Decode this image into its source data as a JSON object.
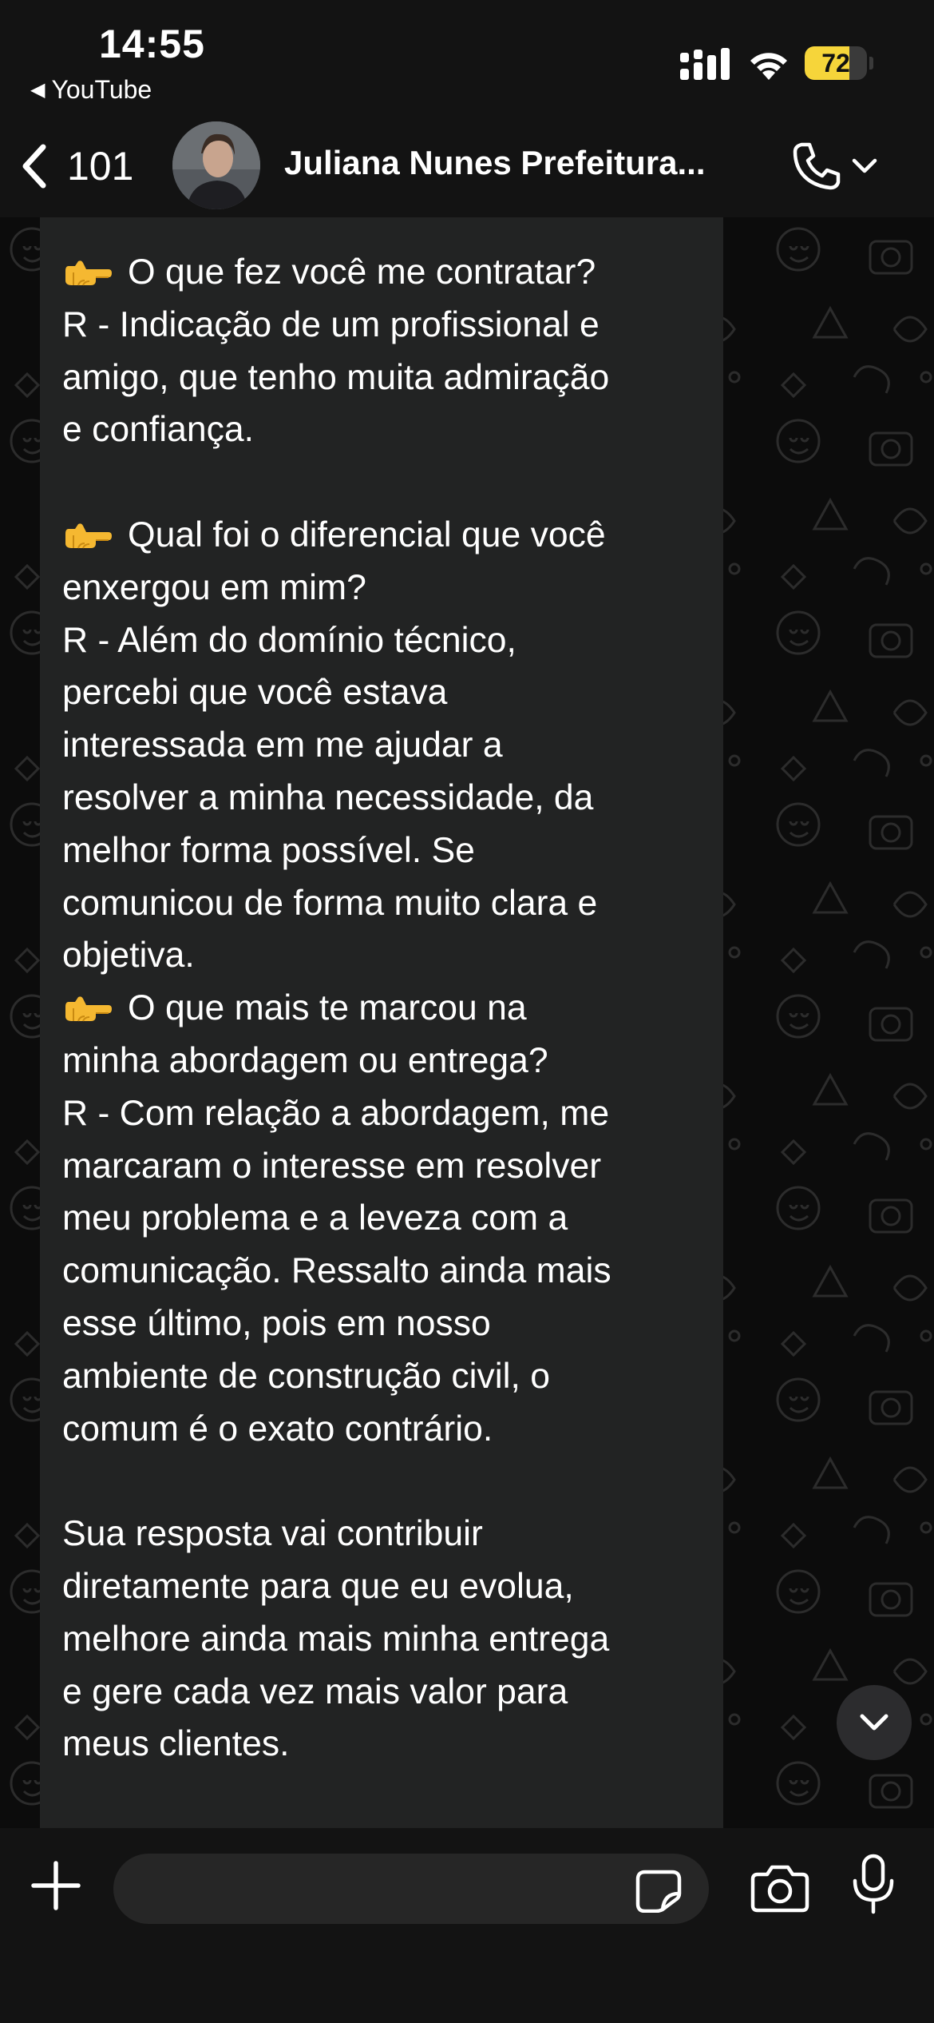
{
  "status_bar": {
    "time": "14:55",
    "back_app": "YouTube",
    "battery_percent": "72",
    "battery_level": 0.72,
    "battery_color": "#f6d53a"
  },
  "header": {
    "unread_count": "101",
    "contact_name": "Juliana Nunes Prefeitura...",
    "back_icon": "chevron-left-icon",
    "call_icon": "phone-icon"
  },
  "message": {
    "lines": [
      {
        "emoji": true,
        "text": "O que fez você me contratar?"
      },
      {
        "emoji": false,
        "text": "R - Indicação de um profissional e"
      },
      {
        "emoji": false,
        "text": "amigo, que tenho muita admiração"
      },
      {
        "emoji": false,
        "text": "e confiança."
      },
      {
        "emoji": false,
        "text": ""
      },
      {
        "emoji": true,
        "text": "Qual foi o diferencial que você"
      },
      {
        "emoji": false,
        "text": "enxergou em mim?"
      },
      {
        "emoji": false,
        "text": "R - Além do domínio técnico,"
      },
      {
        "emoji": false,
        "text": "percebi que você estava"
      },
      {
        "emoji": false,
        "text": "interessada em me ajudar a"
      },
      {
        "emoji": false,
        "text": "resolver a minha necessidade, da"
      },
      {
        "emoji": false,
        "text": "melhor forma possível. Se"
      },
      {
        "emoji": false,
        "text": "comunicou de forma muito clara e"
      },
      {
        "emoji": false,
        "text": "objetiva."
      },
      {
        "emoji": true,
        "text": "O que mais te marcou na"
      },
      {
        "emoji": false,
        "text": "minha abordagem ou entrega?"
      },
      {
        "emoji": false,
        "text": "R - Com relação a abordagem, me"
      },
      {
        "emoji": false,
        "text": "marcaram o interesse em resolver"
      },
      {
        "emoji": false,
        "text": "meu problema e a leveza com a"
      },
      {
        "emoji": false,
        "text": "comunicação. Ressalto ainda mais"
      },
      {
        "emoji": false,
        "text": "esse último, pois em nosso"
      },
      {
        "emoji": false,
        "text": "ambiente de construção civil, o"
      },
      {
        "emoji": false,
        "text": "comum é o exato contrário."
      },
      {
        "emoji": false,
        "text": ""
      },
      {
        "emoji": false,
        "text": "Sua resposta vai contribuir"
      },
      {
        "emoji": false,
        "text": "diretamente para que eu evolua,"
      },
      {
        "emoji": false,
        "text": "melhore ainda mais minha entrega"
      },
      {
        "emoji": false,
        "text": "e gere cada vez mais valor para"
      },
      {
        "emoji": false,
        "text": "meus clientes."
      }
    ]
  },
  "input": {
    "value": "",
    "icons": [
      "plus-icon",
      "sticker-icon",
      "camera-icon",
      "microphone-icon"
    ]
  },
  "colors": {
    "bar_background": "#131313",
    "bubble": "#222323",
    "chat_background": "#0c0c0c",
    "input_field": "#262626"
  }
}
